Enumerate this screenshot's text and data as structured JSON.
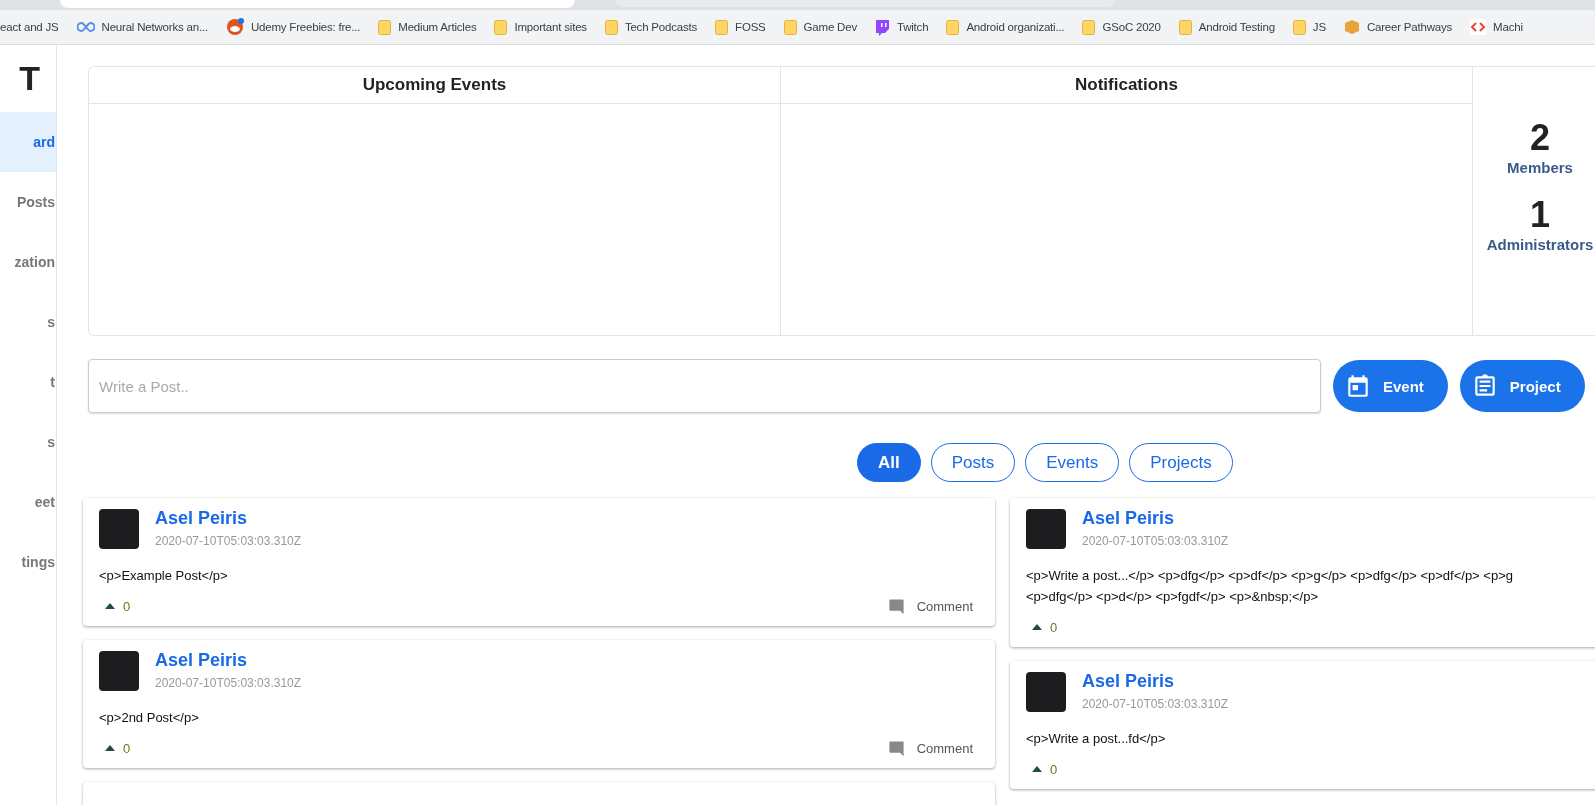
{
  "bookmarks": [
    {
      "label": "eact and JS",
      "kind": "plain"
    },
    {
      "label": "Neural Networks an...",
      "kind": "site"
    },
    {
      "label": "Udemy Freebies: fre...",
      "kind": "site"
    },
    {
      "label": "Medium Articles",
      "kind": "folder"
    },
    {
      "label": "Important sites",
      "kind": "folder"
    },
    {
      "label": "Tech Podcasts",
      "kind": "folder"
    },
    {
      "label": "FOSS",
      "kind": "folder"
    },
    {
      "label": "Game Dev",
      "kind": "folder"
    },
    {
      "label": "Twitch",
      "kind": "site"
    },
    {
      "label": "Android organizati...",
      "kind": "folder"
    },
    {
      "label": "GSoC 2020",
      "kind": "folder"
    },
    {
      "label": "Android Testing",
      "kind": "folder"
    },
    {
      "label": "JS",
      "kind": "folder"
    },
    {
      "label": "Career Pathways",
      "kind": "site"
    },
    {
      "label": "Machi",
      "kind": "site"
    }
  ],
  "sidebar": {
    "logo": "T",
    "items": [
      {
        "label": "ard",
        "selected": true
      },
      {
        "label": "Posts",
        "selected": false
      },
      {
        "label": "zation",
        "selected": false
      },
      {
        "label": "s",
        "selected": false
      },
      {
        "label": "t",
        "selected": false
      },
      {
        "label": "s",
        "selected": false
      },
      {
        "label": "eet",
        "selected": false
      },
      {
        "label": "tings",
        "selected": false
      }
    ]
  },
  "overview": {
    "panels": [
      {
        "title": "Upcoming Events"
      },
      {
        "title": "Notifications"
      }
    ],
    "stats": [
      {
        "value": "2",
        "label": "Members"
      },
      {
        "value": "1",
        "label": "Administrators"
      }
    ]
  },
  "composer": {
    "placeholder": "Write a Post..",
    "buttons": [
      {
        "label": "Event"
      },
      {
        "label": "Project"
      }
    ]
  },
  "filters": [
    {
      "label": "All",
      "selected": true
    },
    {
      "label": "Posts",
      "selected": false
    },
    {
      "label": "Events",
      "selected": false
    },
    {
      "label": "Projects",
      "selected": false
    }
  ],
  "columns": [
    {
      "posts": [
        {
          "author": "Asel Peiris",
          "date": "2020-07-10T05:03:03.310Z",
          "body": [
            "<p>Example Post</p>"
          ],
          "votes": "0",
          "comment": "Comment"
        },
        {
          "author": "Asel Peiris",
          "date": "2020-07-10T05:03:03.310Z",
          "body": [
            "<p>2nd Post</p>"
          ],
          "votes": "0",
          "comment": "Comment"
        }
      ]
    },
    {
      "posts": [
        {
          "author": "Asel Peiris",
          "date": "2020-07-10T05:03:03.310Z",
          "body": [
            "<p>Write a post...</p> <p>dfg</p> <p>df</p> <p>g</p> <p>dfg</p> <p>df</p> <p>g",
            "<p>dfg</p> <p>d</p> <p>fgdf</p> <p>&nbsp;</p>"
          ],
          "votes": "0"
        },
        {
          "author": "Asel Peiris",
          "date": "2020-07-10T05:03:03.310Z",
          "body": [
            "<p>Write a post...fd</p>"
          ],
          "votes": "0"
        }
      ]
    }
  ]
}
